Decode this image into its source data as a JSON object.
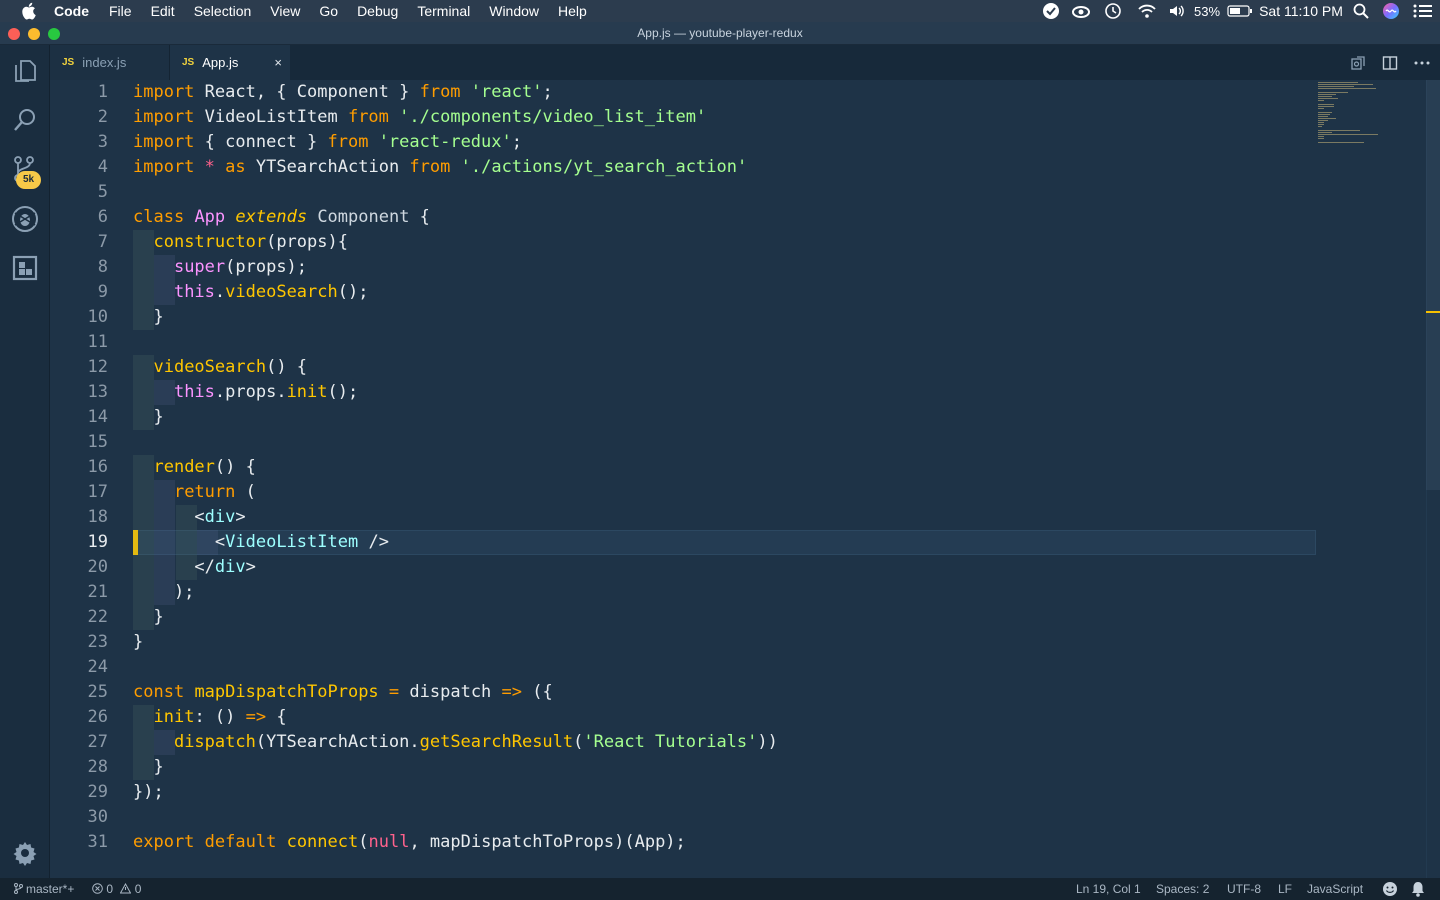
{
  "menubar": {
    "app": "Code",
    "items": [
      "File",
      "Edit",
      "Selection",
      "View",
      "Go",
      "Debug",
      "Terminal",
      "Window",
      "Help"
    ],
    "battery": "53%",
    "clock": "Sat 11:10 PM"
  },
  "window": {
    "title": "App.js — youtube-player-redux"
  },
  "activitybar": {
    "scm_badge": "5k"
  },
  "tabs": [
    {
      "icon": "JS",
      "label": "index.js"
    },
    {
      "icon": "JS",
      "label": "App.js",
      "close": "×"
    }
  ],
  "editor": {
    "active_line": 19,
    "line_numbers": [
      "1",
      "2",
      "3",
      "4",
      "5",
      "6",
      "7",
      "8",
      "9",
      "10",
      "11",
      "12",
      "13",
      "14",
      "15",
      "16",
      "17",
      "18",
      "19",
      "20",
      "21",
      "22",
      "23",
      "24",
      "25",
      "26",
      "27",
      "28",
      "29",
      "30",
      "31"
    ]
  },
  "status": {
    "branch": "master*+",
    "errors": "0",
    "warnings": "0",
    "position": "Ln 19, Col 1",
    "spaces": "Spaces: 2",
    "encoding": "UTF-8",
    "eol": "LF",
    "language": "JavaScript"
  },
  "colors": {
    "editor_bg": "#1e3347",
    "keyword": "#ff9d00",
    "string": "#a5ff90",
    "function": "#ffc600",
    "this": "#fb94ff",
    "tag": "#9effff",
    "accent": "#f7c000"
  }
}
